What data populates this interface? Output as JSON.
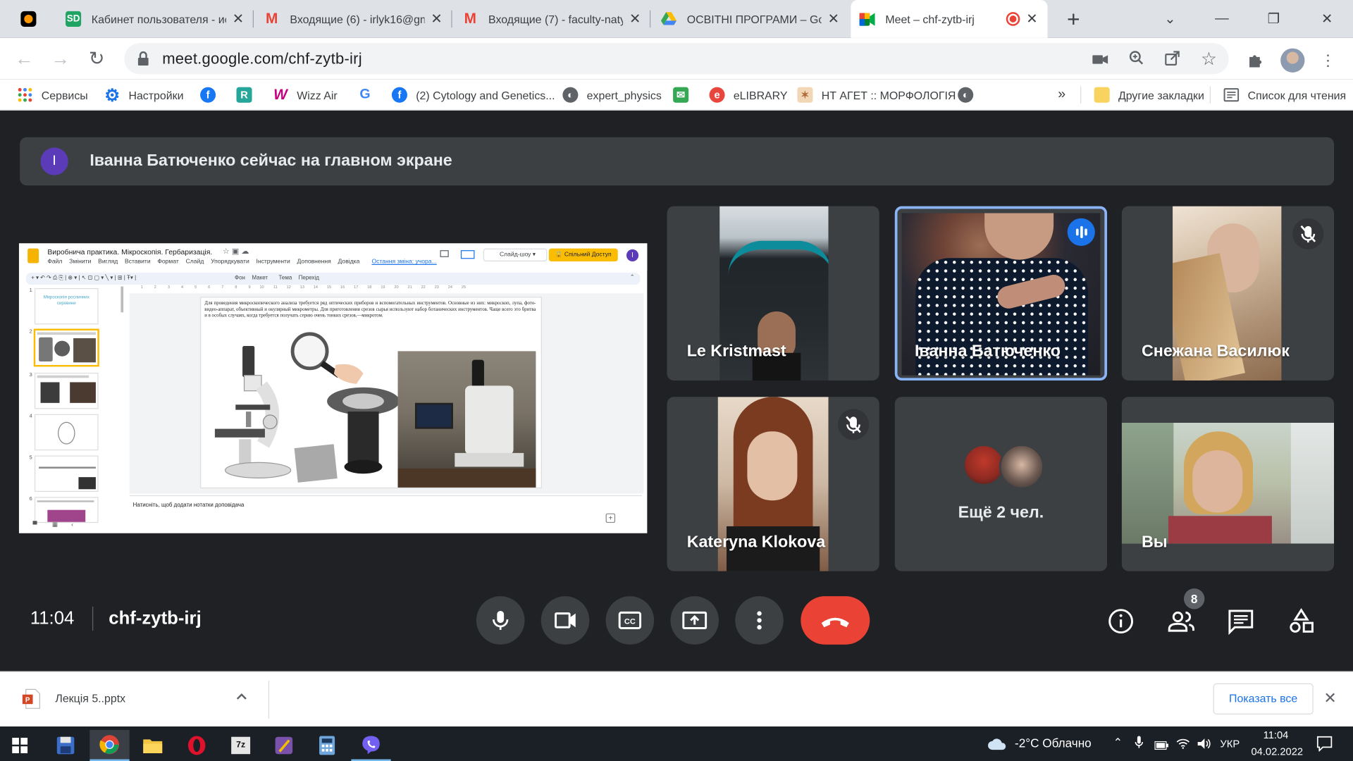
{
  "browser": {
    "tabs": [
      {
        "title": "Кабинет пользователя - ис",
        "icon": "sd-icon",
        "color": "#1fa463"
      },
      {
        "title": "Входящие (6) - irlyk16@gm",
        "icon": "gmail-icon",
        "color": "#ea4335"
      },
      {
        "title": "Входящие (7) - faculty-naty",
        "icon": "gmail-icon",
        "color": "#ea4335"
      },
      {
        "title": "ОСВІТНІ ПРОГРАМИ – Goo",
        "icon": "drive-icon",
        "color": "#1a73e8"
      },
      {
        "title": "Meet – chf-zytb-irj",
        "icon": "meet-icon",
        "color": "#00832d"
      }
    ],
    "url": "meet.google.com/chf-zytb-irj",
    "bookmarks": [
      {
        "label": "Сервисы",
        "icon": "apps-grid-icon",
        "color": "#ea4335"
      },
      {
        "label": "Настройки",
        "icon": "gear-icon",
        "color": "#1a73e8"
      },
      {
        "label": "",
        "icon": "facebook-icon",
        "color": "#1877f2"
      },
      {
        "label": "",
        "icon": "r-icon",
        "color": "#26a69a"
      },
      {
        "label": "Wizz Air",
        "icon": "wizz-icon",
        "color": "#c6007e"
      },
      {
        "label": "",
        "icon": "google-icon",
        "color": "#4285f4"
      },
      {
        "label": "(2) Cytology and Genetics...",
        "icon": "facebook-icon",
        "color": "#1877f2"
      },
      {
        "label": "expert_physics",
        "icon": "globe-icon",
        "color": "#5f6368"
      },
      {
        "label": "",
        "icon": "mail-icon",
        "color": "#34a853"
      },
      {
        "label": "eLIBRARY",
        "icon": "elibrary-icon",
        "color": "#e8453c"
      },
      {
        "label": "НТ АГЕТ :: МОРФОЛОГІЯ",
        "icon": "vitruvian-icon",
        "color": "#b26a3a"
      },
      {
        "label": "",
        "icon": "globe-icon",
        "color": "#5f6368"
      }
    ],
    "more_bookmarks": "»",
    "other_bookmarks": "Другие закладки",
    "reading_list": "Список для чтения"
  },
  "meet": {
    "banner": {
      "avatar": "I",
      "text": "Іванна Батюченко сейчас на главном экране"
    },
    "participants": [
      {
        "name": "Le Kristmast",
        "muted": false
      },
      {
        "name": "Іванна Батюченко",
        "muted": false,
        "speaking": true
      },
      {
        "name": "Снежана Василюк",
        "muted": true
      },
      {
        "name": "Kateryna Klokova",
        "muted": true
      },
      {
        "name": "Ещё 2 чел.",
        "muted": false
      },
      {
        "name": "Вы",
        "muted": false
      }
    ],
    "time": "11:04",
    "code": "chf-zytb-irj",
    "people_count": "8"
  },
  "slides": {
    "title": "Виробнича практика. Мікроскопія. Гербаризація.",
    "menu": [
      "Файл",
      "Змінити",
      "Вигляд",
      "Вставити",
      "Формат",
      "Слайд",
      "Упорядкувати",
      "Інструменти",
      "Доповнення",
      "Довідка"
    ],
    "last_change": "Остання зміна: учора...",
    "slideshow": "Слайд-шоу",
    "share": "Спільний Доступ",
    "user_initial": "I",
    "tool_labels": [
      "Фон",
      "Макет",
      "Тема",
      "Перехід"
    ],
    "ruler": [
      "1",
      "2",
      "3",
      "4",
      "5",
      "6",
      "7",
      "8",
      "9",
      "10",
      "11",
      "12",
      "13",
      "14",
      "15",
      "16",
      "17",
      "18",
      "19",
      "20",
      "21",
      "22",
      "23",
      "24",
      "25"
    ],
    "thumbs": [
      "1",
      "2",
      "3",
      "4",
      "5",
      "6"
    ],
    "thumb1_title": "Мікроскопія рослинних сировини",
    "slide_text": "Для проведения микроскопического анализа требуется ряд оптических приборов и вспомогательных инструментов. Основные из них: микроскоп, лупа, фото-видео-аппарат, объективный и окулярный микрометры. Для приготовления срезов сырья используют набор ботанических инструментов. Чаще всего это бритва и в особых случаях, когда требуется получать серию очень тонких срезов,—микротом.",
    "notes": "Натисніть, щоб додати нотатки доповідача"
  },
  "downloads": {
    "file": "Лекція 5..pptx",
    "show_all": "Показать все"
  },
  "taskbar": {
    "weather": "-2°C  Облачно",
    "lang": "УКР",
    "time": "11:04",
    "date": "04.02.2022"
  }
}
